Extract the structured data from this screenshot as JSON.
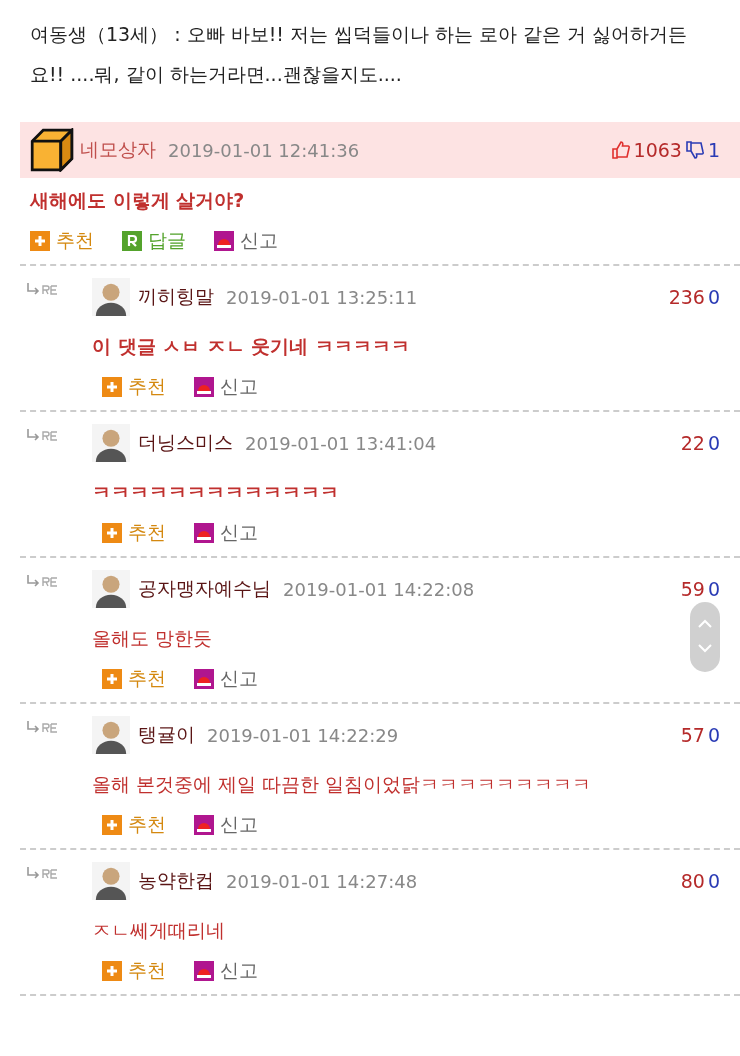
{
  "intro": "여동생（13세） : 오빠 바보!! 저는 씹덕들이나 하는 로아 같은 거 싫어하거든요!! ....뭐, 같이 하는거라면...괜찮을지도....",
  "comment": {
    "author": "네모상자",
    "time": "2019-01-01 12:41:36",
    "up": "1063",
    "down": "1",
    "text": "새해에도 이렇게 살거야?",
    "bold": true,
    "actions": [
      {
        "kind": "recommend",
        "label": "추천"
      },
      {
        "kind": "reply",
        "label": "답글"
      },
      {
        "kind": "report",
        "label": "신고"
      }
    ]
  },
  "replies": [
    {
      "author": "끼히힝말",
      "time": "2019-01-01 13:25:11",
      "up": "236",
      "down": "0",
      "text": "이 댓글 ㅅㅂ ㅈㄴ 웃기네 ㅋㅋㅋㅋㅋ",
      "bold": true,
      "actions": [
        {
          "kind": "recommend",
          "label": "추천"
        },
        {
          "kind": "report",
          "label": "신고"
        }
      ]
    },
    {
      "author": "더닝스미스",
      "time": "2019-01-01 13:41:04",
      "up": "22",
      "down": "0",
      "text": "ㅋㅋㅋㅋㅋㅋㅋㅋㅋㅋㅋㅋㅋ",
      "bold": true,
      "actions": [
        {
          "kind": "recommend",
          "label": "추천"
        },
        {
          "kind": "report",
          "label": "신고"
        }
      ]
    },
    {
      "author": "공자맹자예수님",
      "time": "2019-01-01 14:22:08",
      "up": "59",
      "down": "0",
      "text": "올해도 망한듯",
      "bold": false,
      "actions": [
        {
          "kind": "recommend",
          "label": "추천"
        },
        {
          "kind": "report",
          "label": "신고"
        }
      ]
    },
    {
      "author": "탱귤이",
      "time": "2019-01-01 14:22:29",
      "up": "57",
      "down": "0",
      "text": "올해 본것중에 제일 따끔한 일침이었닭ㅋㅋㅋㅋㅋㅋㅋㅋㅋ",
      "bold": false,
      "actions": [
        {
          "kind": "recommend",
          "label": "추천"
        },
        {
          "kind": "report",
          "label": "신고"
        }
      ]
    },
    {
      "author": "농약한컵",
      "time": "2019-01-01 14:27:48",
      "up": "80",
      "down": "0",
      "text": "ㅈㄴ쎄게때리네",
      "bold": false,
      "actions": [
        {
          "kind": "recommend",
          "label": "추천"
        },
        {
          "kind": "report",
          "label": "신고"
        }
      ]
    }
  ]
}
